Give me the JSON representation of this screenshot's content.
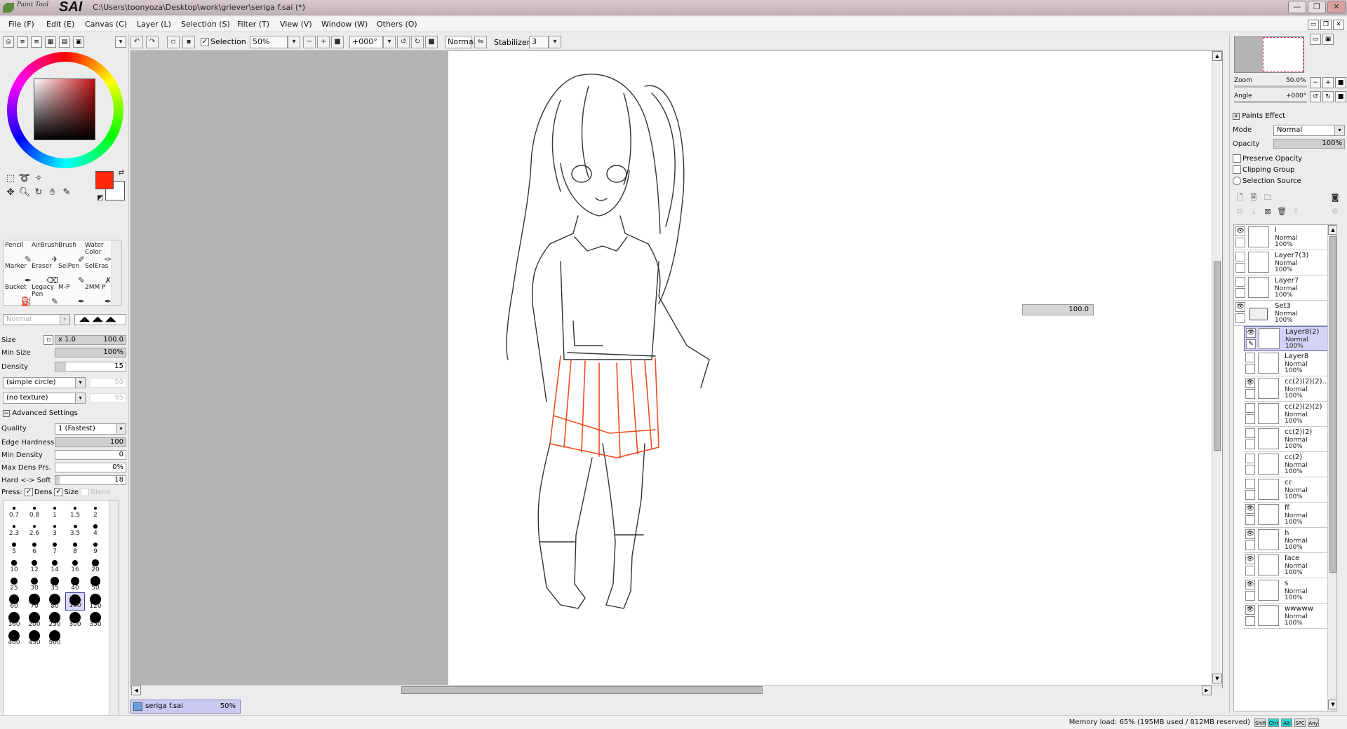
{
  "app": {
    "logo_text": "Paint Tool SAI",
    "path": "C:\\Users\\toonyoza\\Desktop\\work\\griever\\seriga f.sai (*)"
  },
  "window_controls": {
    "minimize": "—",
    "restore": "❐",
    "close": "✕"
  },
  "menu": [
    "File (F)",
    "Edit (E)",
    "Canvas (C)",
    "Layer (L)",
    "Selection (S)",
    "Filter (T)",
    "View (V)",
    "Window (W)",
    "Others (O)"
  ],
  "toolbar": {
    "selection_label": "Selection",
    "selection_checked": true,
    "zoom_value": "50%",
    "angle_value": "+000°",
    "blend_mode": "Normal",
    "stabilizer_label": "Stabilizer",
    "stabilizer_value": "3"
  },
  "colors": {
    "primary": "#ff2a0a",
    "secondary": "#ffffff",
    "accent_select": "#d4d4f8"
  },
  "tools": [
    {
      "label": "Pencil"
    },
    {
      "label": "AirBrush"
    },
    {
      "label": "Brush"
    },
    {
      "label": "Water Color"
    },
    {
      "label": "Marker"
    },
    {
      "label": "Eraser"
    },
    {
      "label": "SelPen"
    },
    {
      "label": "SelEras"
    },
    {
      "label": "Bucket"
    },
    {
      "label": "Legacy Pen"
    },
    {
      "label": "M-P"
    },
    {
      "label": "2MM P"
    }
  ],
  "brush_settings": {
    "blend": "Normal",
    "size_label": "Size",
    "size_mult": "x 1.0",
    "size_value": "100.0",
    "min_size_label": "Min Size",
    "min_size_value": "100%",
    "density_label": "Density",
    "density_value": "15",
    "shape": "(simple circle)",
    "shape_value": "50",
    "texture": "(no texture)",
    "texture_value": "95",
    "advanced_label": "Advanced Settings",
    "quality_label": "Quality",
    "quality_value": "1 (Fastest)",
    "edge_hardness_label": "Edge Hardness",
    "edge_hardness_value": "100",
    "min_density_label": "Min Density",
    "min_density_value": "0",
    "max_dens_label": "Max Dens Prs.",
    "max_dens_value": "0%",
    "hard_soft_label": "Hard <-> Soft",
    "hard_soft_value": "18",
    "press_label": "Press:",
    "press_dens": "Dens",
    "press_size": "Size",
    "press_blend": "Blend"
  },
  "brush_sizes": [
    "0.7",
    "0.8",
    "1",
    "1.5",
    "2",
    "2.3",
    "2.6",
    "3",
    "3.5",
    "4",
    "5",
    "6",
    "7",
    "8",
    "9",
    "10",
    "12",
    "14",
    "16",
    "20",
    "25",
    "30",
    "35",
    "40",
    "50",
    "60",
    "70",
    "80",
    "100",
    "120",
    "160",
    "200",
    "250",
    "300",
    "350",
    "400",
    "450",
    "500"
  ],
  "selected_brush_size": "100",
  "canvas": {
    "floating_value": "100.0"
  },
  "doc_tab": {
    "name": "seriga f.sai",
    "zoom": "50%"
  },
  "navigator": {
    "zoom_label": "Zoom",
    "zoom_value": "50.0%",
    "angle_label": "Angle",
    "angle_value": "+000°"
  },
  "layer_props": {
    "paints_effect_label": "Paints Effect",
    "mode_label": "Mode",
    "mode_value": "Normal",
    "opacity_label": "Opacity",
    "opacity_value": "100%",
    "preserve_opacity": "Preserve Opacity",
    "clipping_group": "Clipping Group",
    "selection_source": "Selection Source"
  },
  "layers": [
    {
      "name": "l",
      "mode": "Normal",
      "opacity": "100%",
      "visible": true,
      "indent": false,
      "folder": false,
      "selected": false
    },
    {
      "name": "Layer7(3)",
      "mode": "Normal",
      "opacity": "100%",
      "visible": false,
      "indent": false,
      "folder": false,
      "selected": false
    },
    {
      "name": "Layer7",
      "mode": "Normal",
      "opacity": "100%",
      "visible": false,
      "indent": false,
      "folder": false,
      "selected": false
    },
    {
      "name": "Set3",
      "mode": "Normal",
      "opacity": "100%",
      "visible": true,
      "indent": false,
      "folder": true,
      "selected": false
    },
    {
      "name": "Layer8(2)",
      "mode": "Normal",
      "opacity": "100%",
      "visible": true,
      "indent": true,
      "folder": false,
      "selected": true
    },
    {
      "name": "Layer8",
      "mode": "Normal",
      "opacity": "100%",
      "visible": false,
      "indent": true,
      "folder": false,
      "selected": false
    },
    {
      "name": "cc(2)(2)(2)...",
      "mode": "Normal",
      "opacity": "100%",
      "visible": true,
      "indent": true,
      "folder": false,
      "selected": false
    },
    {
      "name": "cc(2)(2)(2)",
      "mode": "Normal",
      "opacity": "100%",
      "visible": false,
      "indent": true,
      "folder": false,
      "selected": false
    },
    {
      "name": "cc(2)(2)",
      "mode": "Normal",
      "opacity": "100%",
      "visible": false,
      "indent": true,
      "folder": false,
      "selected": false
    },
    {
      "name": "cc(2)",
      "mode": "Normal",
      "opacity": "100%",
      "visible": false,
      "indent": true,
      "folder": false,
      "selected": false
    },
    {
      "name": "cc",
      "mode": "Normal",
      "opacity": "100%",
      "visible": false,
      "indent": true,
      "folder": false,
      "selected": false
    },
    {
      "name": "ff",
      "mode": "Normal",
      "opacity": "100%",
      "visible": true,
      "indent": true,
      "folder": false,
      "selected": false
    },
    {
      "name": "h",
      "mode": "Normal",
      "opacity": "100%",
      "visible": true,
      "indent": true,
      "folder": false,
      "selected": false
    },
    {
      "name": "face",
      "mode": "Normal",
      "opacity": "100%",
      "visible": true,
      "indent": true,
      "folder": false,
      "selected": false
    },
    {
      "name": "s",
      "mode": "Normal",
      "opacity": "100%",
      "visible": true,
      "indent": true,
      "folder": false,
      "selected": false
    },
    {
      "name": "wwwww",
      "mode": "Normal",
      "opacity": "100%",
      "visible": true,
      "indent": true,
      "folder": false,
      "selected": false
    }
  ],
  "status": {
    "memory": "Memory load: 65% (195MB used / 812MB reserved)",
    "keys": [
      {
        "label": "Shift",
        "on": false
      },
      {
        "label": "Ctrl",
        "on": true
      },
      {
        "label": "Alt",
        "on": true
      },
      {
        "label": "SPC",
        "on": false
      },
      {
        "label": "Any",
        "on": false
      }
    ]
  }
}
